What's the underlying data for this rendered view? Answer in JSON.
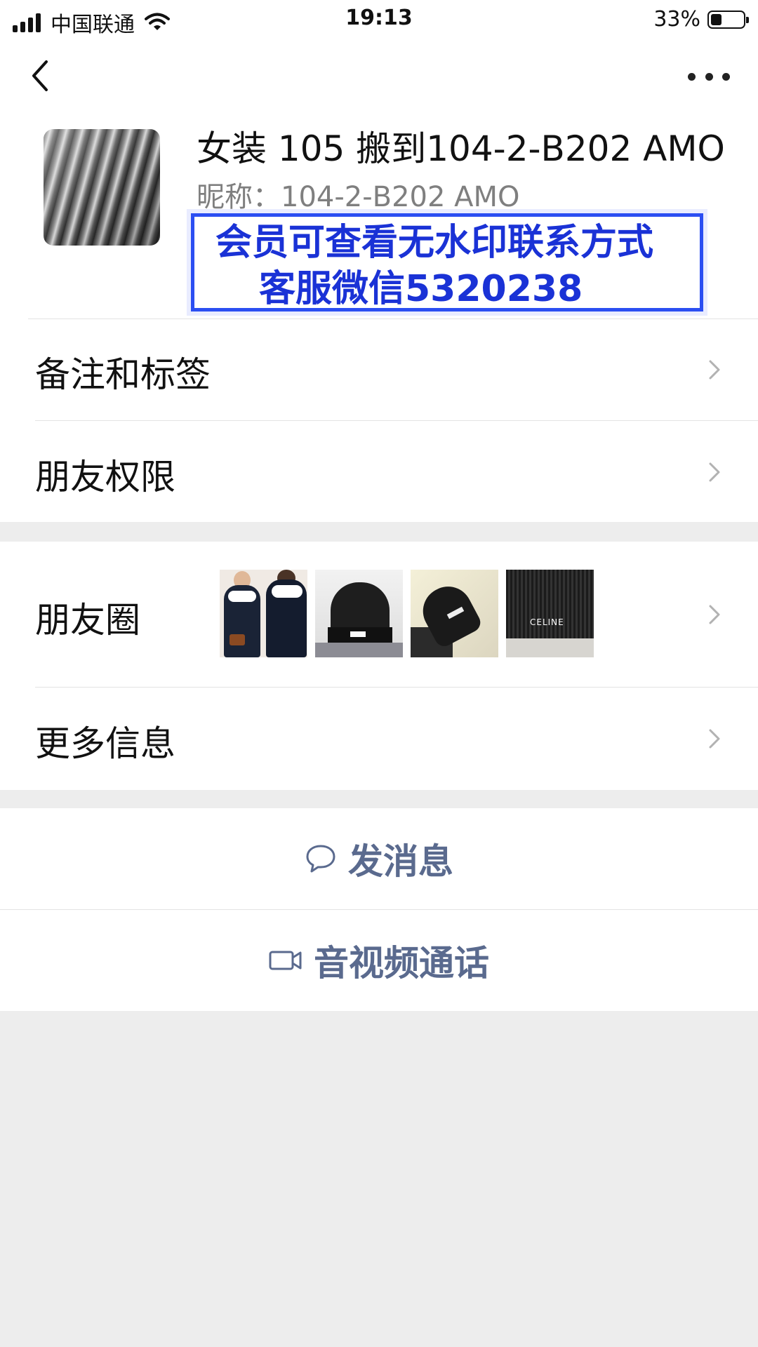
{
  "status_bar": {
    "carrier": "中国联通",
    "time": "19:13",
    "battery_percent": "33%",
    "battery_level": 0.33
  },
  "nav": {
    "back_icon": "chevron-left-icon",
    "more_icon": "ellipsis-icon"
  },
  "profile": {
    "name": "女装 105 搬到104-2-B202 AMO",
    "nickname": "昵称：104-2-B202 AMO",
    "watermark_line1": "会员可查看无水印联系方式",
    "watermark_line2": "客服微信5320238",
    "watermark_color": "#1a32d6"
  },
  "menu_group1": {
    "remarks_label": "备注和标签",
    "permissions_label": "朋友权限"
  },
  "menu_group2": {
    "moments_label": "朋友圈",
    "more_info_label": "更多信息",
    "moments_thumb4_text": "CELINE"
  },
  "actions": {
    "message_label": "发消息",
    "message_icon": "chat-bubble-icon",
    "call_label": "音视频通话",
    "call_icon": "video-camera-icon",
    "action_color": "#5a6a8e"
  }
}
